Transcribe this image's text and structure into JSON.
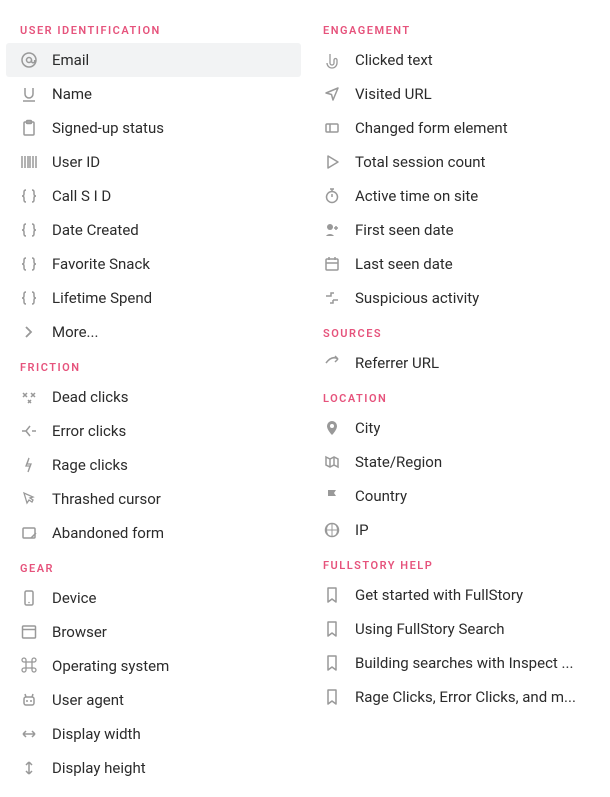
{
  "left": [
    {
      "title": "USER IDENTIFICATION",
      "key": "user-identification",
      "items": [
        {
          "icon": "at-icon",
          "label": "Email",
          "selected": true
        },
        {
          "icon": "underline-icon",
          "label": "Name"
        },
        {
          "icon": "clipboard-icon",
          "label": "Signed-up status"
        },
        {
          "icon": "barcode-icon",
          "label": "User ID"
        },
        {
          "icon": "braces-icon",
          "label": "Call S I D"
        },
        {
          "icon": "braces-icon",
          "label": "Date Created"
        },
        {
          "icon": "braces-icon",
          "label": "Favorite Snack"
        },
        {
          "icon": "braces-icon",
          "label": "Lifetime Spend"
        },
        {
          "icon": "chevron-right-icon",
          "label": "More..."
        }
      ]
    },
    {
      "title": "FRICTION",
      "key": "friction",
      "items": [
        {
          "icon": "dead-click-icon",
          "label": "Dead clicks"
        },
        {
          "icon": "error-click-icon",
          "label": "Error clicks"
        },
        {
          "icon": "rage-click-icon",
          "label": "Rage clicks"
        },
        {
          "icon": "thrashed-cursor-icon",
          "label": "Thrashed cursor"
        },
        {
          "icon": "abandoned-form-icon",
          "label": "Abandoned form"
        }
      ]
    },
    {
      "title": "GEAR",
      "key": "gear",
      "items": [
        {
          "icon": "device-icon",
          "label": "Device"
        },
        {
          "icon": "browser-icon",
          "label": "Browser"
        },
        {
          "icon": "command-icon",
          "label": "Operating system"
        },
        {
          "icon": "robot-icon",
          "label": "User agent"
        },
        {
          "icon": "width-icon",
          "label": "Display width"
        },
        {
          "icon": "height-icon",
          "label": "Display height"
        }
      ]
    }
  ],
  "right": [
    {
      "title": "ENGAGEMENT",
      "key": "engagement",
      "items": [
        {
          "icon": "pointer-icon",
          "label": "Clicked text"
        },
        {
          "icon": "navigation-icon",
          "label": "Visited URL"
        },
        {
          "icon": "form-change-icon",
          "label": "Changed form element"
        },
        {
          "icon": "play-icon",
          "label": "Total session count"
        },
        {
          "icon": "stopwatch-icon",
          "label": "Active time on site"
        },
        {
          "icon": "user-date-icon",
          "label": "First seen date"
        },
        {
          "icon": "calendar-icon",
          "label": "Last seen date"
        },
        {
          "icon": "suspicious-icon",
          "label": "Suspicious activity"
        }
      ]
    },
    {
      "title": "SOURCES",
      "key": "sources",
      "items": [
        {
          "icon": "share-icon",
          "label": "Referrer URL"
        }
      ]
    },
    {
      "title": "LOCATION",
      "key": "location",
      "items": [
        {
          "icon": "pin-icon",
          "label": "City"
        },
        {
          "icon": "map-icon",
          "label": "State/Region"
        },
        {
          "icon": "flag-icon",
          "label": "Country"
        },
        {
          "icon": "globe-icon",
          "label": "IP"
        }
      ]
    },
    {
      "title": "FULLSTORY HELP",
      "key": "fullstory-help",
      "items": [
        {
          "icon": "bookmark-icon",
          "label": "Get started with FullStory"
        },
        {
          "icon": "bookmark-icon",
          "label": "Using FullStory Search"
        },
        {
          "icon": "bookmark-icon",
          "label": "Building searches with Inspect ..."
        },
        {
          "icon": "bookmark-icon",
          "label": "Rage Clicks, Error Clicks, and m..."
        }
      ]
    }
  ]
}
